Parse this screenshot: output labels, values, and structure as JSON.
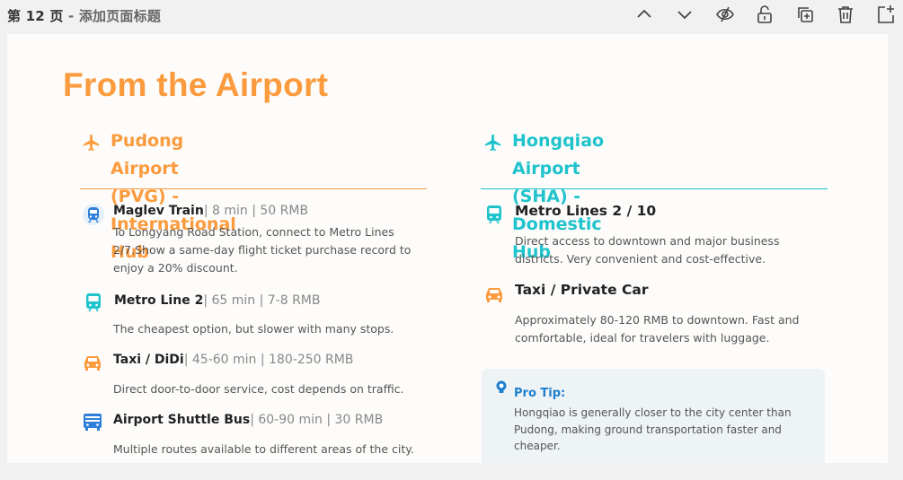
{
  "toolbar": {
    "page_number_label": "第 12 页",
    "separator": " - ",
    "page_title_placeholder": "添加页面标题",
    "icons": [
      "chevron-up-icon",
      "chevron-down-icon",
      "eye-slash-icon",
      "lock-icon",
      "duplicate-icon",
      "trash-icon",
      "add-page-icon"
    ]
  },
  "slide": {
    "title": "From the Airport",
    "accent_orange": "#fb9b3d",
    "accent_teal": "#1fc3cc",
    "left": {
      "heading_line1": "Pudong Airport (PVG) -",
      "heading_line2": "International Hub",
      "items": [
        {
          "title": "Maglev Train",
          "meta": "| 8 min | 50 RMB",
          "desc_lines": [
            "To Longyang Road Station, connect to Metro Lines",
            "2/7.Show a same-day flight ticket purchase record to",
            "enjoy a 20% discount."
          ],
          "icon": "train-icon"
        },
        {
          "title": "Metro Line 2",
          "meta": "| 65 min | 7-8 RMB",
          "desc_lines": [
            "The cheapest option, but slower with many stops."
          ],
          "icon": "metro-icon"
        },
        {
          "title": "Taxi / DiDi",
          "meta": "| 45-60 min | 180-250 RMB",
          "desc_lines": [
            "Direct door-to-door service, cost depends on traffic."
          ],
          "icon": "taxi-icon"
        },
        {
          "title": "Airport Shuttle Bus",
          "meta": "| 60-90 min | 30 RMB",
          "desc_lines": [
            "Multiple routes available to different areas of the city."
          ],
          "icon": "bus-icon"
        }
      ]
    },
    "right": {
      "heading_line1": "Hongqiao Airport (SHA) - Domestic",
      "heading_line2": "Hub",
      "items": [
        {
          "title": "Metro Lines 2 / 10",
          "desc_lines": [
            "Direct access to downtown and major business",
            "districts. Very convenient and cost-effective."
          ],
          "icon": "metro-icon"
        },
        {
          "title": "Taxi / Private Car",
          "desc_lines": [
            "Approximately 80-120 RMB to downtown. Fast and",
            "comfortable, ideal for travelers with luggage."
          ],
          "icon": "taxi-icon"
        }
      ],
      "pro_tip": {
        "title": "Pro Tip:",
        "text_lines": [
          "Hongqiao is generally closer to the city center than",
          "Pudong, making ground transportation faster and",
          "cheaper."
        ],
        "icon": "lightbulb-icon"
      }
    }
  }
}
